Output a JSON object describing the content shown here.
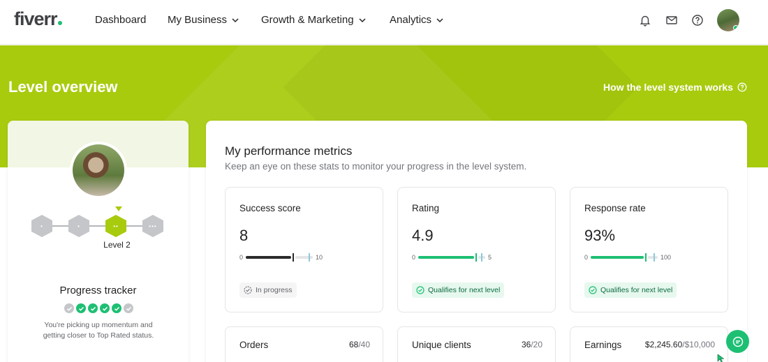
{
  "nav": {
    "logo": "fiverr",
    "items": [
      {
        "label": "Dashboard",
        "has_dropdown": false
      },
      {
        "label": "My Business",
        "has_dropdown": true
      },
      {
        "label": "Growth & Marketing",
        "has_dropdown": true
      },
      {
        "label": "Analytics",
        "has_dropdown": true
      }
    ],
    "icons": [
      "bell-icon",
      "envelope-icon",
      "help-icon"
    ]
  },
  "hero": {
    "title": "Level overview",
    "link": "How the level system works"
  },
  "profile": {
    "current_level": "Level 2",
    "tracker_title": "Progress tracker",
    "tracker_steps": [
      false,
      true,
      true,
      true,
      true,
      false
    ],
    "tracker_text": "You're picking up momentum and getting closer to Top Rated status."
  },
  "metrics": {
    "title": "My performance metrics",
    "subtitle": "Keep an eye on these stats to monitor your progress in the level system.",
    "cards": [
      {
        "label": "Success score",
        "value": "8",
        "min": "0",
        "max": "10",
        "fill": 0.8,
        "status": "In progress",
        "qualifies": false
      },
      {
        "label": "Rating",
        "value": "4.9",
        "min": "0",
        "max": "5",
        "fill": 0.98,
        "status": "Qualifies for next level",
        "qualifies": true
      },
      {
        "label": "Response rate",
        "value": "93%",
        "min": "0",
        "max": "100",
        "fill": 0.93,
        "status": "Qualifies for next level",
        "qualifies": true
      }
    ],
    "secondary": [
      {
        "label": "Orders",
        "value": "68",
        "target": "/40"
      },
      {
        "label": "Unique clients",
        "value": "36",
        "target": "/20"
      },
      {
        "label": "Earnings",
        "value": "$2,245.60",
        "target": "/$10,000"
      }
    ]
  },
  "colors": {
    "brand_green": "#1dbf73",
    "lime": "#a8cb0e",
    "dark": "#222325"
  }
}
